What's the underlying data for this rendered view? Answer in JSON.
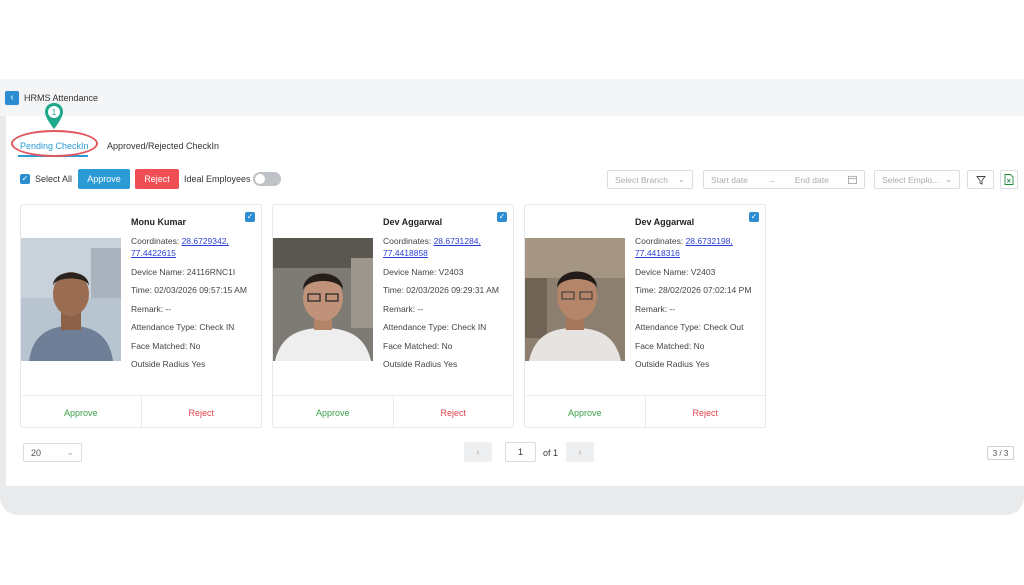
{
  "app": {
    "title": "HRMS Attendance"
  },
  "marker": {
    "number": "1"
  },
  "tabs": [
    {
      "label": "Pending CheckIn",
      "active": true
    },
    {
      "label": "Approved/Rejected CheckIn",
      "active": false
    }
  ],
  "toolbar": {
    "select_all": "Select All",
    "approve": "Approve",
    "reject": "Reject",
    "ideal_employees": "Ideal Employees"
  },
  "filters": {
    "branch_placeholder": "Select Branch",
    "start_date": "Start date",
    "end_date": "End date",
    "employee_placeholder": "Select Emplo..."
  },
  "cards": [
    {
      "name": "Monu Kumar",
      "coords_label": "Coordinates: ",
      "coords": "28.6729342, 77.4422615",
      "device": "Device Name: 24116RNC1I",
      "time": "Time: 02/03/2026 09:57:15 AM",
      "remark": "Remark: --",
      "attendance_type": "Attendance Type: Check IN",
      "face_matched": "Face Matched: No",
      "outside_radius": "Outside Radius Yes",
      "approve": "Approve",
      "reject": "Reject"
    },
    {
      "name": "Dev Aggarwal",
      "coords_label": "Coordinates: ",
      "coords": "28.6731284, 77.4418858",
      "device": "Device Name: V2403",
      "time": "Time: 02/03/2026 09:29:31 AM",
      "remark": "Remark: --",
      "attendance_type": "Attendance Type: Check IN",
      "face_matched": "Face Matched: No",
      "outside_radius": "Outside Radius Yes",
      "approve": "Approve",
      "reject": "Reject"
    },
    {
      "name": "Dev Aggarwal",
      "coords_label": "Coordinates: ",
      "coords": "28.6732198, 77.4418316",
      "device": "Device Name: V2403",
      "time": "Time: 28/02/2026 07:02:14 PM",
      "remark": "Remark: --",
      "attendance_type": "Attendance Type: Check Out",
      "face_matched": "Face Matched: No",
      "outside_radius": "Outside Radius Yes",
      "approve": "Approve",
      "reject": "Reject"
    }
  ],
  "pagination": {
    "page_size": "20",
    "current_page": "1",
    "of_label": "of 1",
    "count": "3 / 3"
  },
  "colors": {
    "primary": "#2b9bd6",
    "danger": "#ee4e54",
    "success": "#3aa04a",
    "marker": "#1fa88a"
  }
}
